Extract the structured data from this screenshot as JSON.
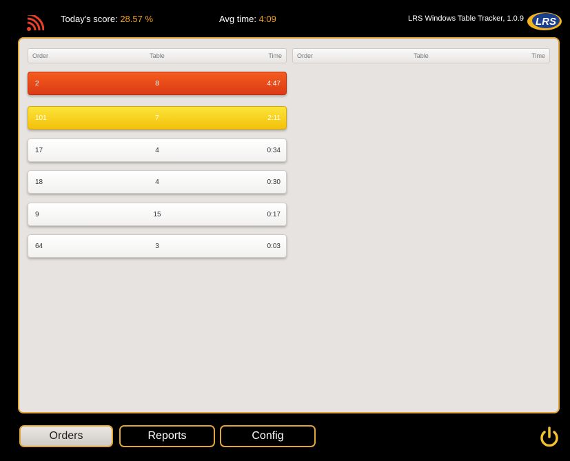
{
  "header": {
    "score_label": "Today's score:",
    "score_value": "28.57 %",
    "avg_label": "Avg time:",
    "avg_value": "4:09",
    "app_title": "LRS Windows Table Tracker, 1.0.9",
    "logo_text": "LRS",
    "icons": {
      "feed": "rss-icon",
      "logo": "lrs-logo"
    }
  },
  "columns": {
    "order": "Order",
    "table": "Table",
    "time": "Time"
  },
  "orders": [
    {
      "order": "2",
      "table": "8",
      "time": "4:47",
      "status": "red"
    },
    {
      "order": "101",
      "table": "7",
      "time": "2:11",
      "status": "yellow"
    },
    {
      "order": "17",
      "table": "4",
      "time": "0:34",
      "status": "normal"
    },
    {
      "order": "18",
      "table": "4",
      "time": "0:30",
      "status": "normal"
    },
    {
      "order": "9",
      "table": "15",
      "time": "0:17",
      "status": "normal"
    },
    {
      "order": "64",
      "table": "3",
      "time": "0:03",
      "status": "normal"
    }
  ],
  "nav": {
    "orders": "Orders",
    "reports": "Reports",
    "config": "Config",
    "power_icon": "power-icon"
  },
  "colors": {
    "accent": "#e3a53a",
    "score_value": "#f0a020",
    "late_red": "#e8461a",
    "warning_yellow": "#f7d020"
  }
}
